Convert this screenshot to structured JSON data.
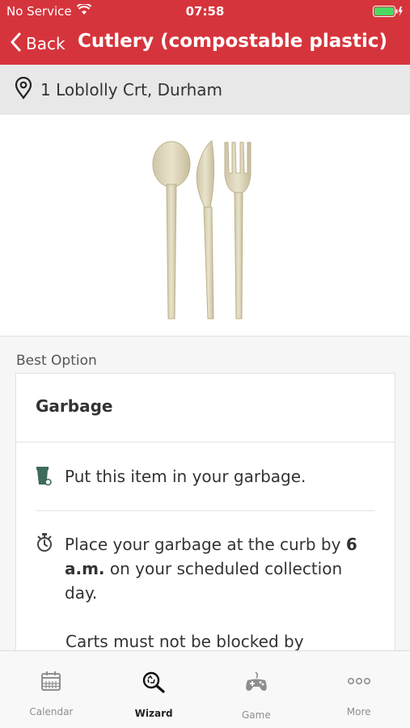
{
  "status": {
    "carrier": "No Service",
    "time": "07:58"
  },
  "nav": {
    "back_label": "Back",
    "title": "Cutlery (compostable plastic)"
  },
  "address": {
    "text": "1 Loblolly Crt, Durham",
    "icon": "location-pin-icon"
  },
  "item_image": {
    "icon": "cutlery-image"
  },
  "best_option": {
    "label": "Best Option",
    "title": "Garbage",
    "instruction": "Put this item in your garbage.",
    "curb_prefix": "Place your garbage at the curb by ",
    "curb_time": "6 a.m.",
    "curb_suffix": " on your scheduled collection day.",
    "carts_note": "Carts must not be blocked by"
  },
  "tabs": [
    {
      "label": "Calendar",
      "icon": "calendar-icon",
      "active": false
    },
    {
      "label": "Wizard",
      "icon": "wizard-search-icon",
      "active": true
    },
    {
      "label": "Game",
      "icon": "gamepad-icon",
      "active": false
    },
    {
      "label": "More",
      "icon": "more-dots-icon",
      "active": false
    }
  ],
  "colors": {
    "brand_red": "#d6343c",
    "bin_green": "#3f6b5a",
    "battery_green": "#4cd964"
  }
}
